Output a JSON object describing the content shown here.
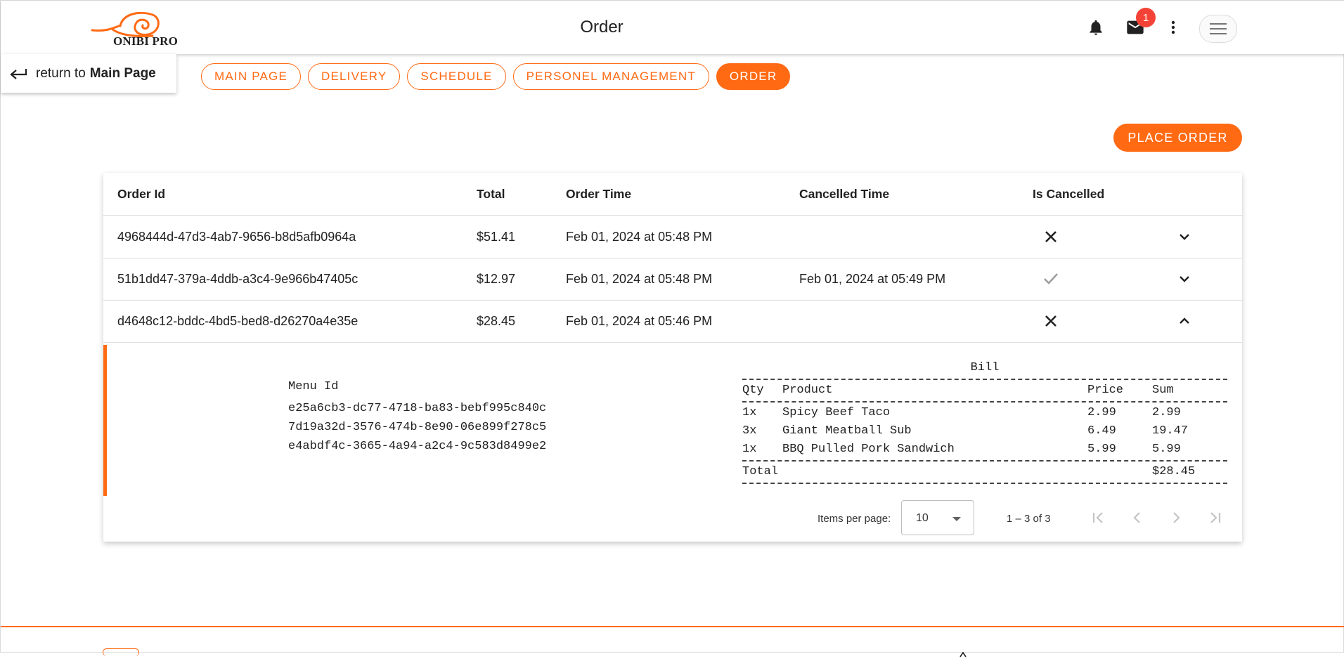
{
  "header": {
    "logo_text": "ONIBI PRO",
    "title": "Order",
    "notification_count": "1",
    "icons": [
      "bell-icon",
      "mail-icon",
      "more-vert-icon",
      "hamburger-menu-icon"
    ]
  },
  "return_link": {
    "prefix": "return to",
    "target": "Main Page"
  },
  "nav": {
    "items": [
      {
        "label": "MAIN PAGE"
      },
      {
        "label": "DELIVERY"
      },
      {
        "label": "SCHEDULE"
      },
      {
        "label": "PERSONEL MANAGEMENT"
      },
      {
        "label": "ORDER"
      }
    ],
    "active": "ORDER"
  },
  "actions": {
    "place_order": "PLACE ORDER"
  },
  "table": {
    "headers": {
      "order_id": "Order Id",
      "total": "Total",
      "order_time": "Order Time",
      "cancelled_time": "Cancelled Time",
      "is_cancelled": "Is Cancelled"
    },
    "rows": [
      {
        "order_id": "4968444d-47d3-4ab7-9656-b8d5afb0964a",
        "total": "$51.41",
        "order_time": "Feb 01, 2024 at 05:48 PM",
        "cancelled_time": "",
        "is_cancelled": false,
        "expanded": false
      },
      {
        "order_id": "51b1dd47-379a-4ddb-a3c4-9e966b47405c",
        "total": "$12.97",
        "order_time": "Feb 01, 2024 at 05:48 PM",
        "cancelled_time": "Feb 01, 2024 at 05:49 PM",
        "is_cancelled": true,
        "expanded": false
      },
      {
        "order_id": "d4648c12-bddc-4bd5-bed8-d26270a4e35e",
        "total": "$28.45",
        "order_time": "Feb 01, 2024 at 05:46 PM",
        "cancelled_time": "",
        "is_cancelled": false,
        "expanded": true
      }
    ],
    "detail": {
      "menu_id_header": "Menu Id",
      "menu_ids": [
        "e25a6cb3-dc77-4718-ba83-bebf995c840c",
        "7d19a32d-3576-474b-8e90-06e899f278c5",
        "e4abdf4c-3665-4a94-a2c4-9c583d8499e2"
      ],
      "bill": {
        "title": "Bill",
        "headers": {
          "qty": "Qty",
          "product": "Product",
          "price": "Price",
          "sum": "Sum"
        },
        "items": [
          {
            "qty": "1x",
            "product": "Spicy Beef Taco",
            "price": "2.99",
            "sum": "2.99"
          },
          {
            "qty": "3x",
            "product": "Giant Meatball Sub",
            "price": "6.49",
            "sum": "19.47"
          },
          {
            "qty": "1x",
            "product": "BBQ Pulled Pork Sandwich",
            "price": "5.99",
            "sum": "5.99"
          }
        ],
        "total_label": "Total",
        "total_value": "$28.45"
      }
    }
  },
  "paginator": {
    "items_per_page_label": "Items per page:",
    "page_size": "10",
    "range": "1 – 3 of 3"
  },
  "colors": {
    "accent": "#ff6a13",
    "badge": "#f44336"
  }
}
